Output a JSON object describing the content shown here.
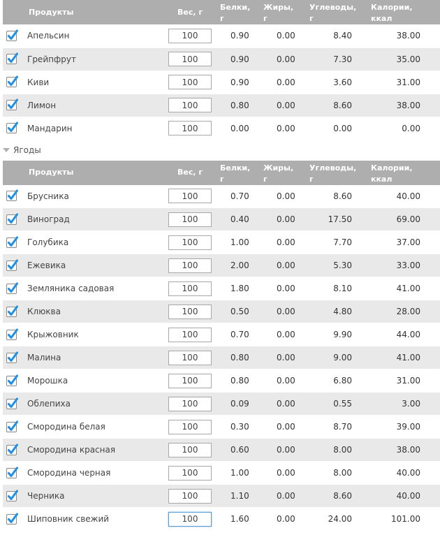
{
  "columns": {
    "product": "Продукты",
    "weight": "Вес, г",
    "protein": [
      "Белки,",
      "г"
    ],
    "fat": [
      "Жиры,",
      "г"
    ],
    "carbs": [
      "Углеводы,",
      "г"
    ],
    "calories": [
      "Калории,",
      "ккал"
    ]
  },
  "groups": [
    {
      "name": "",
      "rows": [
        {
          "name": "Апельсин",
          "weight": "100",
          "protein": "0.90",
          "fat": "0.00",
          "carbs": "8.40",
          "calories": "38.00",
          "checked": true
        },
        {
          "name": "Грейпфрут",
          "weight": "100",
          "protein": "0.90",
          "fat": "0.00",
          "carbs": "7.30",
          "calories": "35.00",
          "checked": true
        },
        {
          "name": "Киви",
          "weight": "100",
          "protein": "0.90",
          "fat": "0.00",
          "carbs": "3.60",
          "calories": "31.00",
          "checked": true
        },
        {
          "name": "Лимон",
          "weight": "100",
          "protein": "0.80",
          "fat": "0.00",
          "carbs": "8.60",
          "calories": "38.00",
          "checked": true
        },
        {
          "name": "Мандарин",
          "weight": "100",
          "protein": "0.00",
          "fat": "0.00",
          "carbs": "0.00",
          "calories": "0.00",
          "checked": true
        }
      ]
    },
    {
      "name": "Ягоды",
      "rows": [
        {
          "name": "Брусника",
          "weight": "100",
          "protein": "0.70",
          "fat": "0.00",
          "carbs": "8.60",
          "calories": "40.00",
          "checked": true
        },
        {
          "name": "Виноград",
          "weight": "100",
          "protein": "0.40",
          "fat": "0.00",
          "carbs": "17.50",
          "calories": "69.00",
          "checked": true
        },
        {
          "name": "Голубика",
          "weight": "100",
          "protein": "1.00",
          "fat": "0.00",
          "carbs": "7.70",
          "calories": "37.00",
          "checked": true
        },
        {
          "name": "Ежевика",
          "weight": "100",
          "protein": "2.00",
          "fat": "0.00",
          "carbs": "5.30",
          "calories": "33.00",
          "checked": true
        },
        {
          "name": "Земляника садовая",
          "weight": "100",
          "protein": "1.80",
          "fat": "0.00",
          "carbs": "8.10",
          "calories": "41.00",
          "checked": true
        },
        {
          "name": "Клюква",
          "weight": "100",
          "protein": "0.50",
          "fat": "0.00",
          "carbs": "4.80",
          "calories": "28.00",
          "checked": true
        },
        {
          "name": "Крыжовник",
          "weight": "100",
          "protein": "0.70",
          "fat": "0.00",
          "carbs": "9.90",
          "calories": "44.00",
          "checked": true
        },
        {
          "name": "Малина",
          "weight": "100",
          "protein": "0.80",
          "fat": "0.00",
          "carbs": "9.00",
          "calories": "41.00",
          "checked": true
        },
        {
          "name": "Морошка",
          "weight": "100",
          "protein": "0.80",
          "fat": "0.00",
          "carbs": "6.80",
          "calories": "31.00",
          "checked": true
        },
        {
          "name": "Облепиха",
          "weight": "100",
          "protein": "0.09",
          "fat": "0.00",
          "carbs": "0.55",
          "calories": "3.00",
          "checked": true
        },
        {
          "name": "Смородина белая",
          "weight": "100",
          "protein": "0.30",
          "fat": "0.00",
          "carbs": "8.70",
          "calories": "39.00",
          "checked": true
        },
        {
          "name": "Смородина красная",
          "weight": "100",
          "protein": "0.60",
          "fat": "0.00",
          "carbs": "8.00",
          "calories": "38.00",
          "checked": true
        },
        {
          "name": "Смородина черная",
          "weight": "100",
          "protein": "1.00",
          "fat": "0.00",
          "carbs": "8.00",
          "calories": "40.00",
          "checked": true
        },
        {
          "name": "Черника",
          "weight": "100",
          "protein": "1.10",
          "fat": "0.00",
          "carbs": "8.60",
          "calories": "40.00",
          "checked": true
        },
        {
          "name": "Шиповник свежий",
          "weight": "100",
          "protein": "1.60",
          "fat": "0.00",
          "carbs": "24.00",
          "calories": "101.00",
          "checked": true,
          "focused": true
        }
      ]
    }
  ],
  "icons": {
    "checkbox": "checkmark-icon",
    "group_toggle": "triangle-down-icon"
  },
  "colors": {
    "header_bg": "#aeaeae",
    "row_alt": "#e9e9e9",
    "check": "#1e8fe6"
  }
}
